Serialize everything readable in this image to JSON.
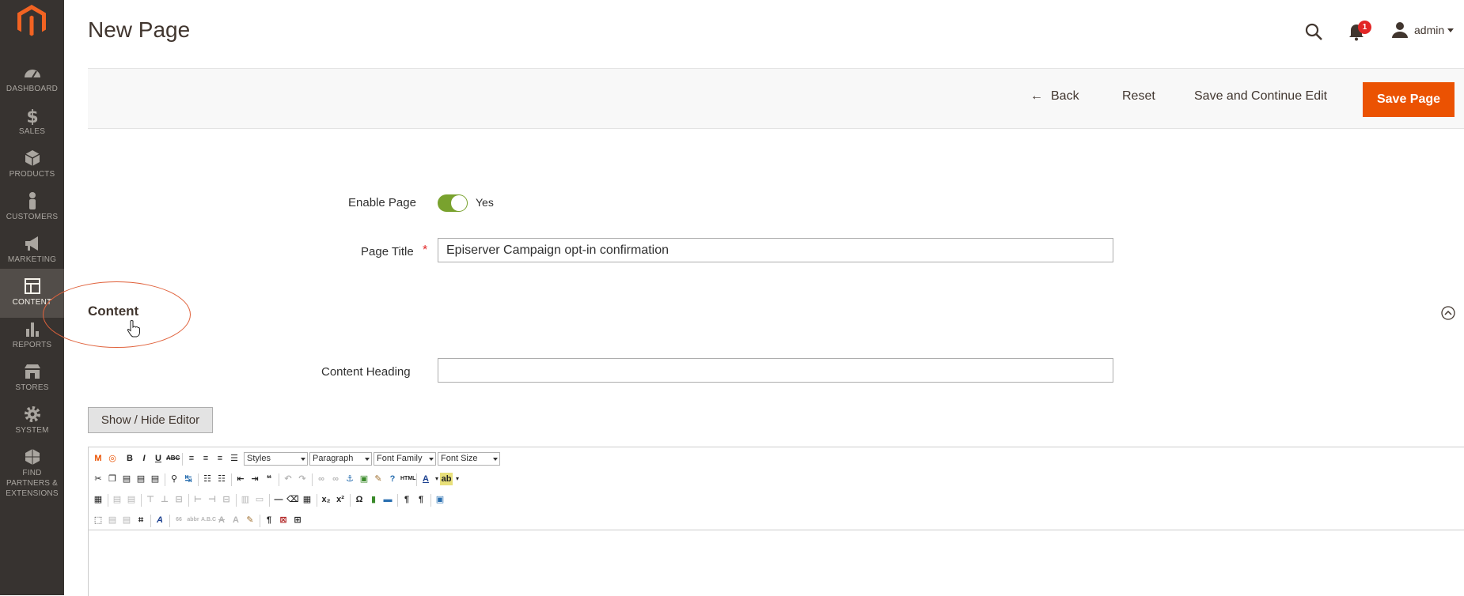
{
  "sidebar": {
    "items": [
      {
        "label": "DASHBOARD"
      },
      {
        "label": "SALES"
      },
      {
        "label": "PRODUCTS"
      },
      {
        "label": "CUSTOMERS"
      },
      {
        "label": "MARKETING"
      },
      {
        "label": "CONTENT",
        "active": true
      },
      {
        "label": "REPORTS"
      },
      {
        "label": "STORES"
      },
      {
        "label": "SYSTEM"
      },
      {
        "label": "FIND PARTNERS & EXTENSIONS"
      }
    ]
  },
  "header": {
    "title": "New Page",
    "notifications_count": "1",
    "user": "admin"
  },
  "actions": {
    "back": "Back",
    "reset": "Reset",
    "save_continue": "Save and Continue Edit",
    "save": "Save Page"
  },
  "form": {
    "enable_label": "Enable Page",
    "enable_value": "Yes",
    "title_label": "Page Title",
    "title_required_mark": "*",
    "title_value": "Episerver Campaign opt-in confirmation",
    "content_section": "Content",
    "heading_label": "Content Heading",
    "heading_value": "",
    "show_hide_editor": "Show / Hide Editor"
  },
  "editor_toolbar": {
    "styles": "Styles",
    "paragraph": "Paragraph",
    "font_family": "Font Family",
    "font_size": "Font Size"
  },
  "colors": {
    "sidebar": "#373330",
    "accent": "#eb5202",
    "toggle_on": "#79a22e"
  }
}
